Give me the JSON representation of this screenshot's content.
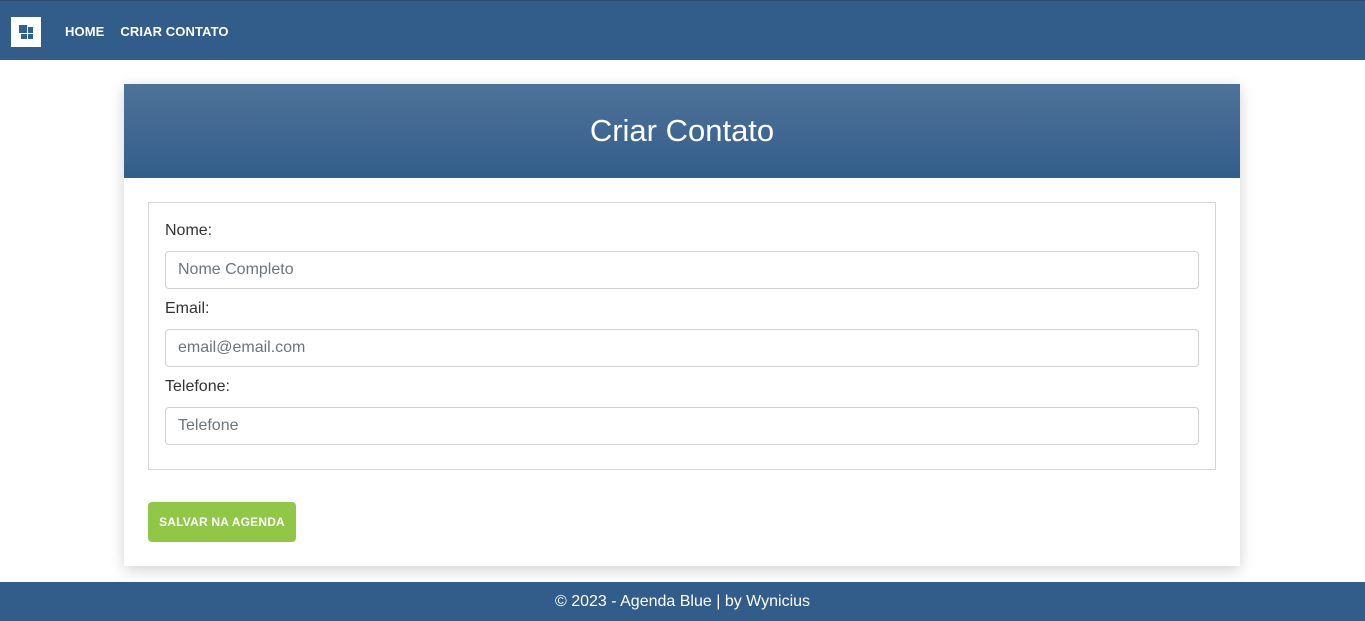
{
  "nav": {
    "logo_icon": "windows-grid-icon",
    "links": [
      {
        "label": "HOME"
      },
      {
        "label": "CRIAR CONTATO"
      }
    ]
  },
  "card": {
    "title": "Criar Contato"
  },
  "form": {
    "name_label": "Nome:",
    "name_placeholder": "Nome Completo",
    "email_label": "Email:",
    "email_placeholder": "email@email.com",
    "phone_label": "Telefone:",
    "phone_placeholder": "Telefone",
    "save_label": "SALVAR NA AGENDA"
  },
  "footer": {
    "text": "© 2023 - Agenda Blue | by Wynicius"
  },
  "colors": {
    "primary": "#325c8a",
    "accent_green": "#90c747"
  }
}
